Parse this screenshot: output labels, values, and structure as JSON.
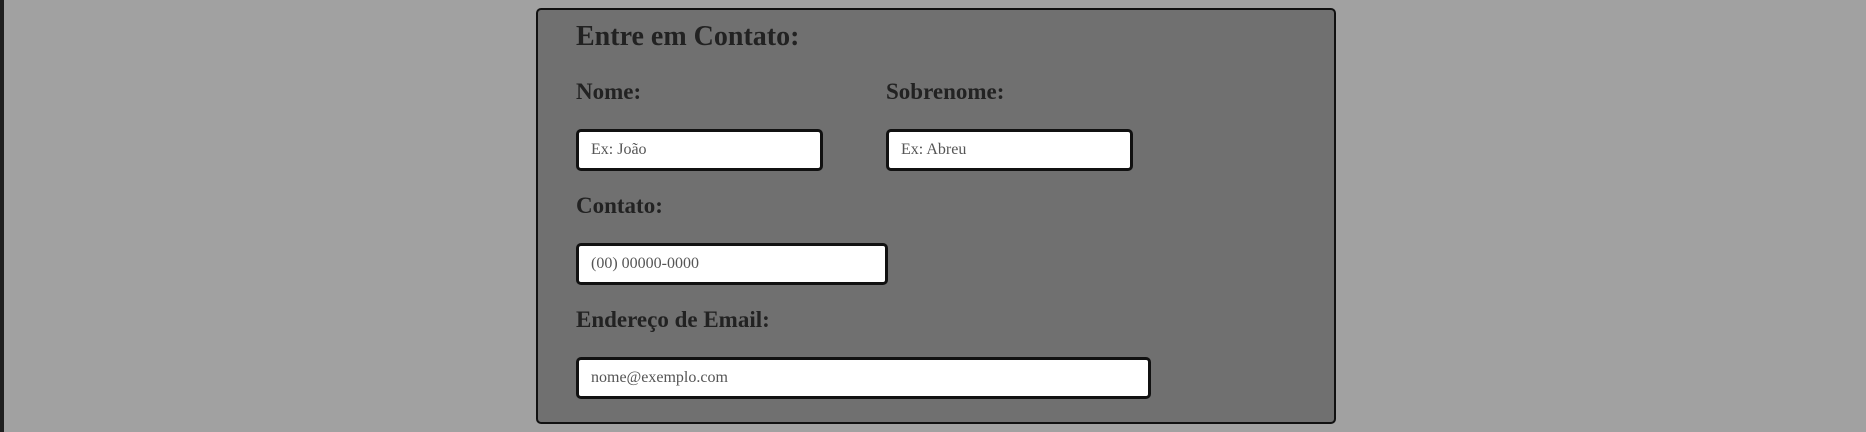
{
  "form": {
    "title": "Entre em Contato:",
    "fields": {
      "nome": {
        "label": "Nome:",
        "placeholder": "Ex: João",
        "value": ""
      },
      "sobrenome": {
        "label": "Sobrenome:",
        "placeholder": "Ex: Abreu",
        "value": ""
      },
      "contato": {
        "label": "Contato:",
        "placeholder": "(00) 00000-0000",
        "value": ""
      },
      "email": {
        "label": "Endereço de Email:",
        "placeholder": "nome@exemplo.com",
        "value": ""
      }
    }
  },
  "colors": {
    "page_background": "#a1a1a1",
    "card_background": "#707070",
    "border": "#111111",
    "text": "#222222",
    "field_background": "#ffffff"
  }
}
